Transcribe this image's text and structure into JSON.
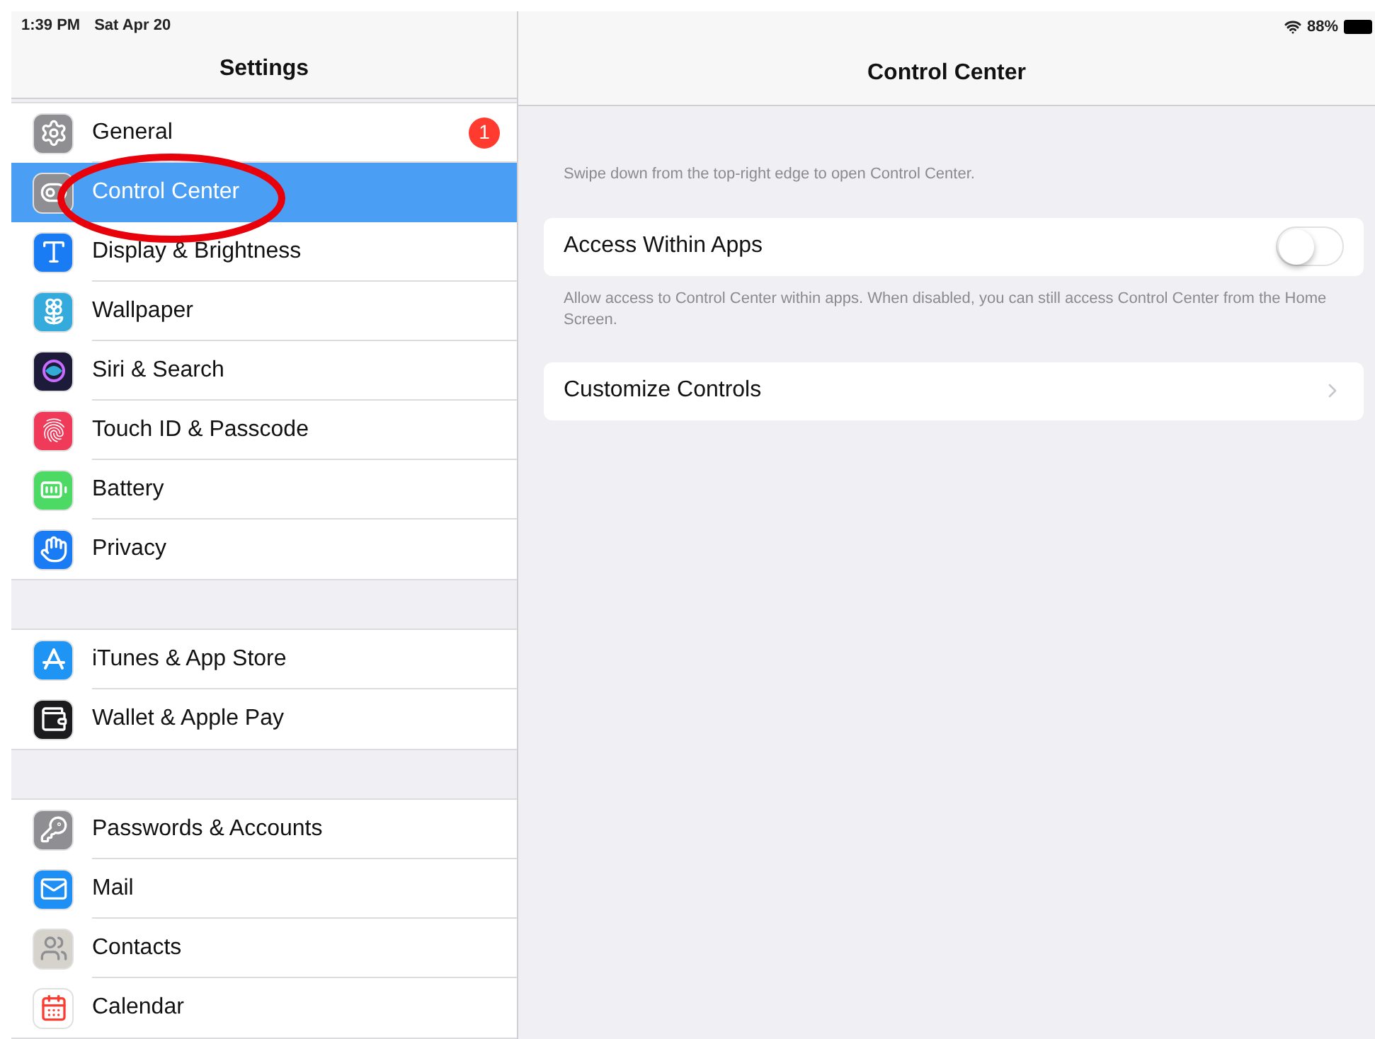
{
  "status_bar": {
    "time": "1:39 PM",
    "date": "Sat Apr 20",
    "battery": "88%"
  },
  "sidebar": {
    "title": "Settings",
    "groups": [
      {
        "items": [
          {
            "label": "General",
            "selected": false,
            "color": "#8e8e93",
            "badge": "1"
          },
          {
            "label": "Control Center",
            "selected": true,
            "color": "#8e8e93"
          },
          {
            "label": "Display & Brightness",
            "selected": false,
            "color": "#1a7cf5"
          },
          {
            "label": "Wallpaper",
            "selected": false,
            "color": "#35aadc"
          },
          {
            "label": "Siri & Search",
            "selected": false,
            "color": "#1c1c3a"
          },
          {
            "label": "Touch ID & Passcode",
            "selected": false,
            "color": "#f03a5a"
          },
          {
            "label": "Battery",
            "selected": false,
            "color": "#4cd964"
          },
          {
            "label": "Privacy",
            "selected": false,
            "color": "#1a7cf5"
          }
        ]
      },
      {
        "items": [
          {
            "label": "iTunes & App Store",
            "selected": false,
            "color": "#1e95f4"
          },
          {
            "label": "Wallet & Apple Pay",
            "selected": false,
            "color": "#1c1c1e"
          }
        ]
      },
      {
        "items": [
          {
            "label": "Passwords & Accounts",
            "selected": false,
            "color": "#8e8e93"
          },
          {
            "label": "Mail",
            "selected": false,
            "color": "#1e8ff5"
          },
          {
            "label": "Contacts",
            "selected": false,
            "color": "#d6d3cc"
          },
          {
            "label": "Calendar",
            "selected": false,
            "color": "#ffffff"
          }
        ]
      }
    ]
  },
  "detail": {
    "title": "Control Center",
    "note": "Swipe down from the top-right edge to open Control Center.",
    "settings": [
      {
        "kind": "toggle",
        "label": "Access Within Apps",
        "on": false,
        "footer": "Allow access to Control Center within apps. When disabled, you can still access Control Center from the Home Screen."
      },
      {
        "kind": "link",
        "label": "Customize Controls"
      }
    ]
  }
}
